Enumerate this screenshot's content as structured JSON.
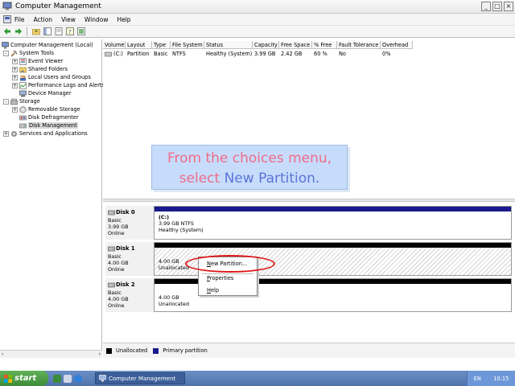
{
  "window": {
    "title": "Computer Management",
    "buttons": {
      "minimize": "_",
      "maximize": "□",
      "close": "×"
    }
  },
  "menubar": {
    "items": [
      "File",
      "Action",
      "View",
      "Window",
      "Help"
    ]
  },
  "toolbar": {
    "icons": [
      "back-arrow-icon",
      "forward-arrow-icon",
      "up-folder-icon",
      "show-hide-tree-icon",
      "properties-icon",
      "help-icon",
      "export-list-icon"
    ]
  },
  "tree": {
    "root": "Computer Management (Local)",
    "system_tools": "System Tools",
    "event_viewer": "Event Viewer",
    "shared_folders": "Shared Folders",
    "local_users": "Local Users and Groups",
    "perf_logs": "Performance Logs and Alerts",
    "device_manager": "Device Manager",
    "storage": "Storage",
    "removable_storage": "Removable Storage",
    "disk_defrag": "Disk Defragmenter",
    "disk_management": "Disk Management",
    "services_apps": "Services and Applications"
  },
  "volume_list": {
    "columns": [
      "Volume",
      "Layout",
      "Type",
      "File System",
      "Status",
      "Capacity",
      "Free Space",
      "% Free",
      "Fault Tolerance",
      "Overhead"
    ],
    "rows": [
      [
        "(C:)",
        "Partition",
        "Basic",
        "NTFS",
        "Healthy (System)",
        "3.99 GB",
        "2.42 GB",
        "60 %",
        "No",
        "0%"
      ]
    ]
  },
  "callout": {
    "line1": "From the choices menu,",
    "line2_prefix": "select ",
    "line2_highlight": "New Partition."
  },
  "disks": [
    {
      "name": "Disk 0",
      "type": "Basic",
      "size": "3.99 GB",
      "state": "Online",
      "partition_title": "(C:)",
      "partition_size": "3.99 GB NTFS",
      "partition_status": "Healthy (System)"
    },
    {
      "name": "Disk 1",
      "type": "Basic",
      "size": "4.00 GB",
      "state": "Online",
      "partition_size": "4.00 GB",
      "partition_status": "Unallocated"
    },
    {
      "name": "Disk 2",
      "type": "Basic",
      "size": "4.00 GB",
      "state": "Online",
      "partition_size": "4.00 GB",
      "partition_status": "Unallocated"
    }
  ],
  "legend": {
    "unallocated": "Unallocated",
    "primary": "Primary partition"
  },
  "context_menu": {
    "new_partition": "New Partition...",
    "new_partition_first": "N",
    "new_partition_rest": "ew Partition...",
    "properties_first": "P",
    "properties_rest": "roperties",
    "help_first": "H",
    "help_rest": "elp"
  },
  "taskbar": {
    "start": "start",
    "task": "Computer Management",
    "lang": "EN",
    "clock": "10:15"
  },
  "colors": {
    "primary_partition": "#1a1a8c",
    "unallocated": "#000000",
    "highlight_ellipse": "#e01818",
    "callout_bg": "#c7dcfb"
  }
}
